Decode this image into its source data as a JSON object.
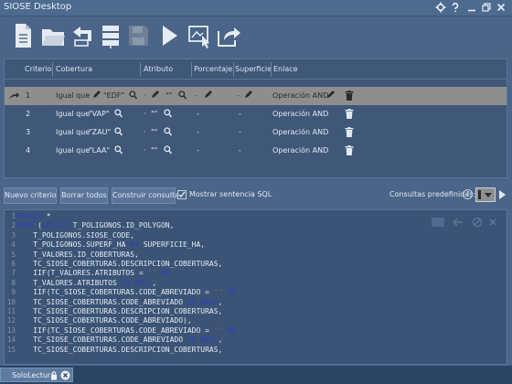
{
  "window": {
    "title": "SIOSE Desktop"
  },
  "toolbar": {
    "buttons": [
      {
        "name": "new-document-button",
        "icon": "new-document-icon"
      },
      {
        "name": "open-folder-button",
        "icon": "open-folder-icon"
      },
      {
        "name": "back-button",
        "icon": "back-arrow-icon"
      },
      {
        "name": "database-button",
        "icon": "database-icon"
      },
      {
        "name": "save-button",
        "icon": "save-icon"
      },
      {
        "name": "run-button",
        "icon": "play-icon"
      },
      {
        "name": "map-select-button",
        "icon": "map-select-icon"
      },
      {
        "name": "export-button",
        "icon": "export-icon"
      }
    ]
  },
  "grid": {
    "headers": [
      "Criterio",
      "Cobertura",
      "Atributo",
      "Porcentaje",
      "Superficie",
      "Enlace"
    ],
    "rows": [
      {
        "criterio": "1",
        "cobertura": "Igual que",
        "cobertura_val": "\"EDF\"",
        "atributo_op": "·",
        "atributo_val": "\"\"",
        "porcentaje": "-",
        "superficie": "-",
        "enlace": "Operación AND",
        "selected": true
      },
      {
        "criterio": "2",
        "cobertura": "Igual que",
        "cobertura_val": "\"VAP\"",
        "atributo_op": "·",
        "atributo_val": "\"\"",
        "porcentaje": "-",
        "superficie": "-",
        "enlace": "Operación AND",
        "selected": false
      },
      {
        "criterio": "3",
        "cobertura": "Igual que",
        "cobertura_val": "\"ZAU\"",
        "atributo_op": "·",
        "atributo_val": "\"\"",
        "porcentaje": "-",
        "superficie": "-",
        "enlace": "Operación AND",
        "selected": false
      },
      {
        "criterio": "4",
        "cobertura": "Igual que",
        "cobertura_val": "\"LAA\"",
        "atributo_op": "·",
        "atributo_val": "\"\"",
        "porcentaje": "-",
        "superficie": "-",
        "enlace": "Operación AND",
        "selected": false
      }
    ]
  },
  "actions": {
    "new_criterion": "Nuevo criterio",
    "clear_all": "Borrar todos",
    "build_query": "Construir consulta",
    "show_sql": "Mostrar sentencia SQL",
    "show_sql_checked": true,
    "predefined_label": "Consultas predefinidas:",
    "help_glyph": "?"
  },
  "sql": {
    "lines": [
      "SELECT *",
      "FROM (SELECT T_POLIGONOS.ID_POLYGON,",
      "    T_POLIGONOS.SIOSE_CODE,",
      "    T_POLIGONOS.SUPERF_HA AS SUPERFICIE_HA,",
      "    T_VALORES.ID_COBERTURAS,",
      "    TC_SIOSE_COBERTURAS.DESCRIPCION_COBERTURAS,",
      "    IIF(T_VALORES.ATRIBUTOS = '' OR",
      "    T_VALORES.ATRIBUTOS IS NULL,",
      "    IIF(TC_SIOSE_COBERTURAS.CODE_ABREVIADO = '' OR",
      "    TC_SIOSE_COBERTURAS.CODE_ABREVIADO IS NULL,",
      "    TC_SIOSE_COBERTURAS.DESCRIPCION_COBERTURAS,",
      "    TC_SIOSE_COBERTURAS.CODE_ABREVIADO),",
      "    IIF(TC_SIOSE_COBERTURAS.CODE_ABREVIADO = '' OR",
      "    TC_SIOSE_COBERTURAS.CODE_ABREVIADO IS NULL,",
      "    TC_SIOSE_COBERTURAS.DESCRIPCION_COBERTURAS,"
    ]
  },
  "status": {
    "tab_label": "SoloLectura"
  },
  "colors": {
    "background": "#4a6588",
    "selected_row": "#8e8e8e",
    "sql_keyword": "#2b3fc4",
    "status_bar": "#2c4464"
  }
}
